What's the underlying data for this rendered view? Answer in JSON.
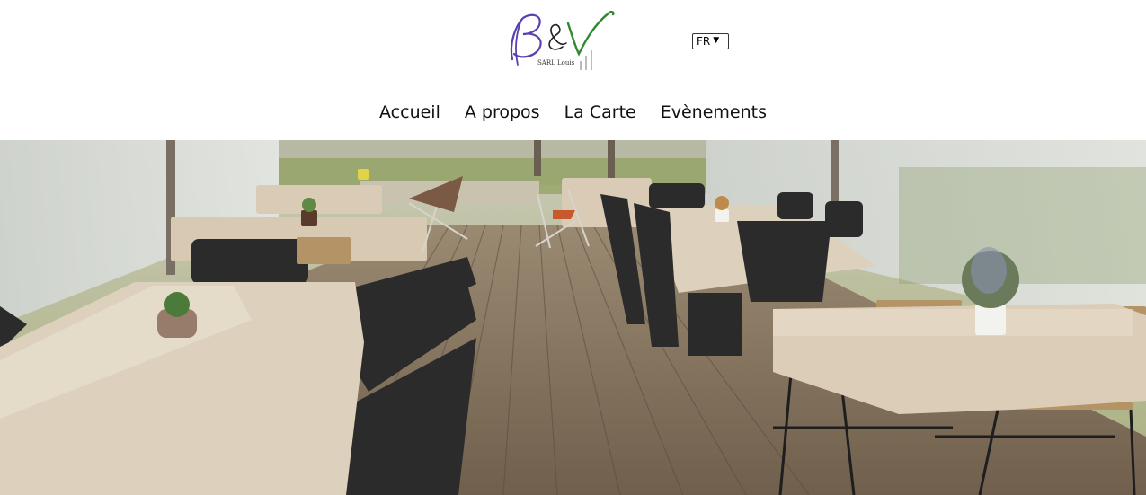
{
  "header": {
    "logo_alt": "B&V",
    "logo_subtitle": "SARL Louis",
    "language": {
      "selected": "FR"
    }
  },
  "nav": {
    "items": [
      {
        "label": "Accueil"
      },
      {
        "label": "A propos"
      },
      {
        "label": "La Carte"
      },
      {
        "label": "Evènements"
      }
    ]
  },
  "hero": {
    "description": "Terrace restaurant under a tent with wooden deck, tables with beige tablecloths and black chairs"
  },
  "colors": {
    "logo_b": "#5a3fb0",
    "logo_v": "#2f8a2f",
    "nav_text": "#111111",
    "deck": "#8c7a63"
  }
}
